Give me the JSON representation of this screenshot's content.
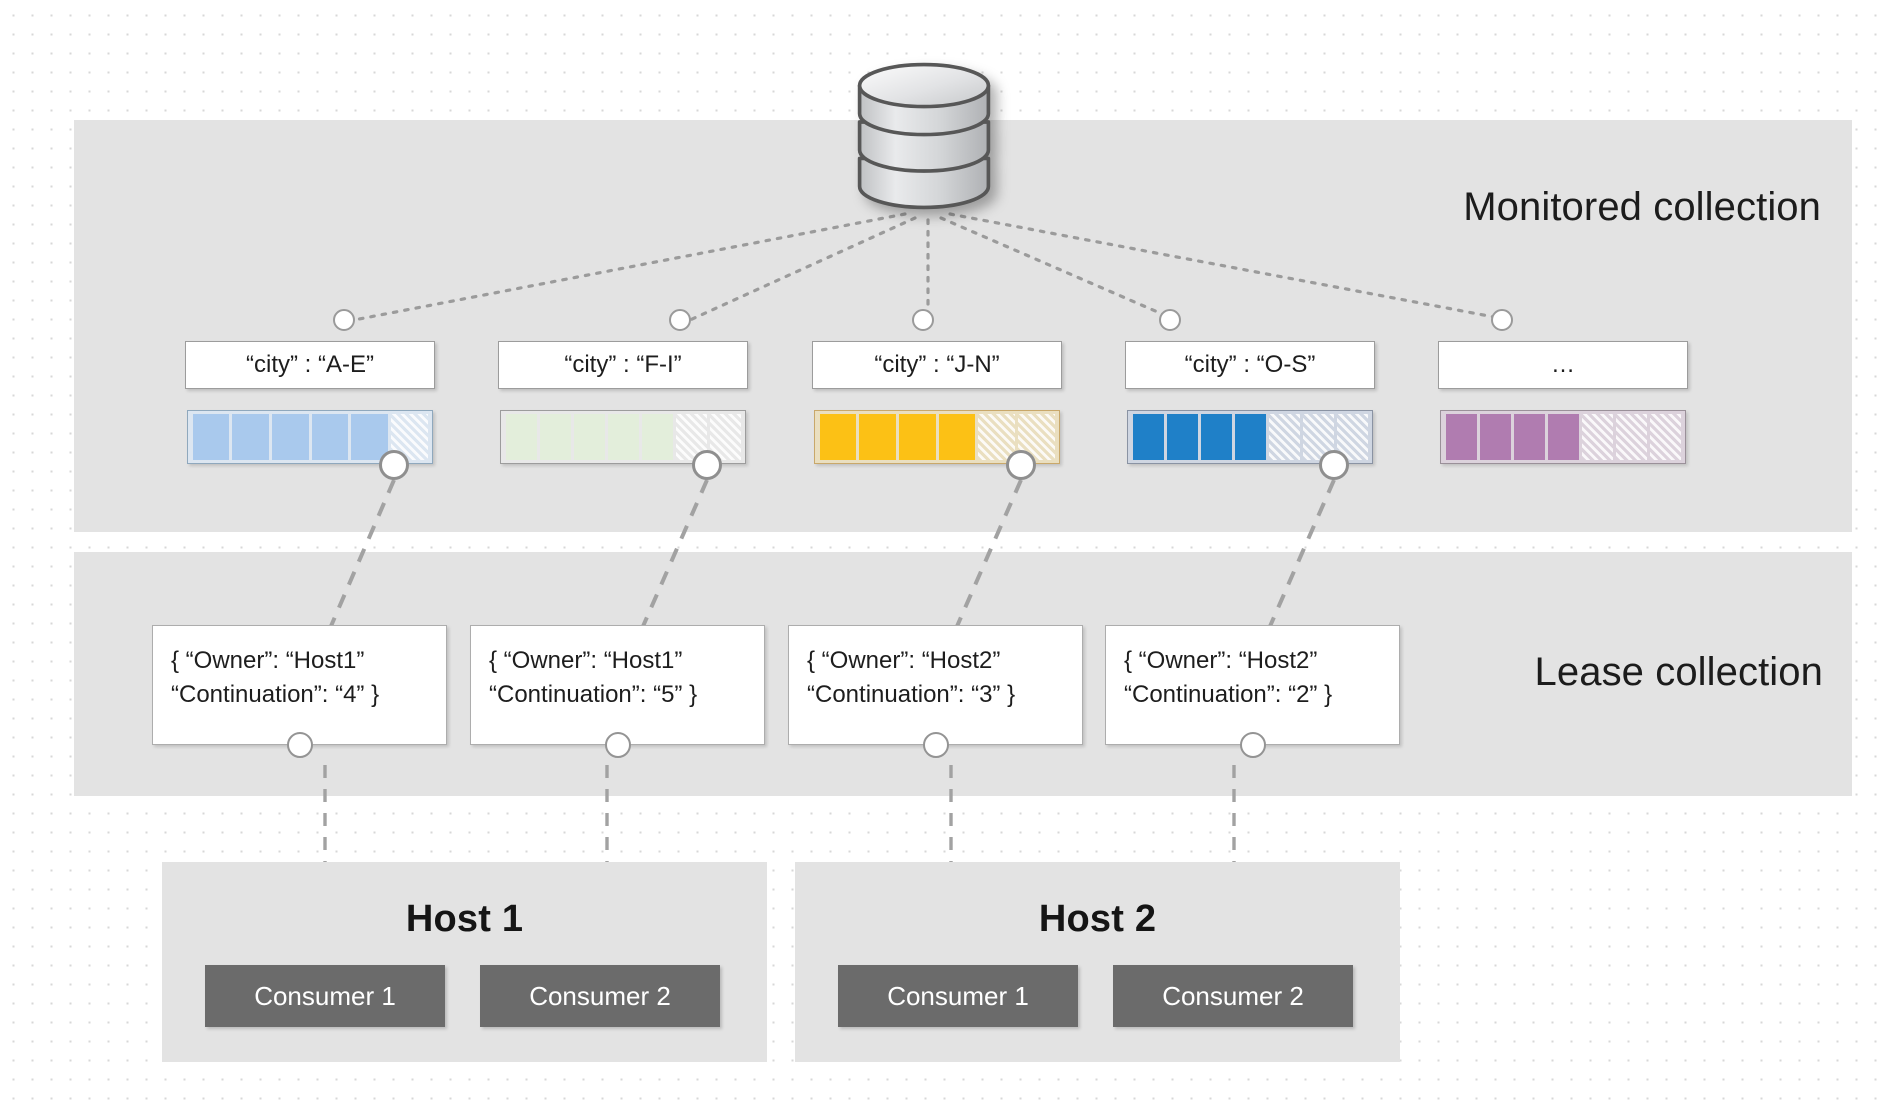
{
  "diagram": {
    "title_monitored": "Monitored collection",
    "title_lease": "Lease collection",
    "database_icon": "database-cylinder-icon"
  },
  "partitions": [
    {
      "label": "“city” : “A-E”",
      "filled": 5,
      "total": 6,
      "fill": "#A9C9ED",
      "border": "#8FA8BD",
      "track": "#DCE6F1"
    },
    {
      "label": "“city” : “F-I”",
      "filled": 5,
      "total": 7,
      "fill": "#E3EEDB",
      "border": "#9C9C9C",
      "track": "#E8E8E8"
    },
    {
      "label": "“city” : “J-N”",
      "filled": 4,
      "total": 6,
      "fill": "#FCC115",
      "border": "#C9A86A",
      "track": "#EADFC0"
    },
    {
      "label": "“city” : “O-S”",
      "filled": 4,
      "total": 7,
      "fill": "#1F80C8",
      "border": "#8A93A3",
      "track": "#CFD6E2"
    },
    {
      "label": "…",
      "filled": 4,
      "total": 7,
      "fill": "#B07CB0",
      "border": "#9A9099",
      "track": "#DCD2DC"
    }
  ],
  "leases": [
    {
      "line1": "{ “Owner”: “Host1”",
      "line2": "“Continuation”: “4” }"
    },
    {
      "line1": "{ “Owner”: “Host1”",
      "line2": "“Continuation”: “5” }"
    },
    {
      "line1": "{ “Owner”: “Host2”",
      "line2": "“Continuation”: “3” }"
    },
    {
      "line1": "{ “Owner”: “Host2”",
      "line2": "“Continuation”: “2” }"
    }
  ],
  "hosts": [
    {
      "title": "Host 1",
      "consumers": [
        "Consumer 1",
        "Consumer 2"
      ]
    },
    {
      "title": "Host 2",
      "consumers": [
        "Consumer 1",
        "Consumer 2"
      ]
    }
  ],
  "colors": {
    "band_bg": "#E3E3E3",
    "consumer_bg": "#6B6B6B",
    "wire": "#9B9B9B"
  }
}
